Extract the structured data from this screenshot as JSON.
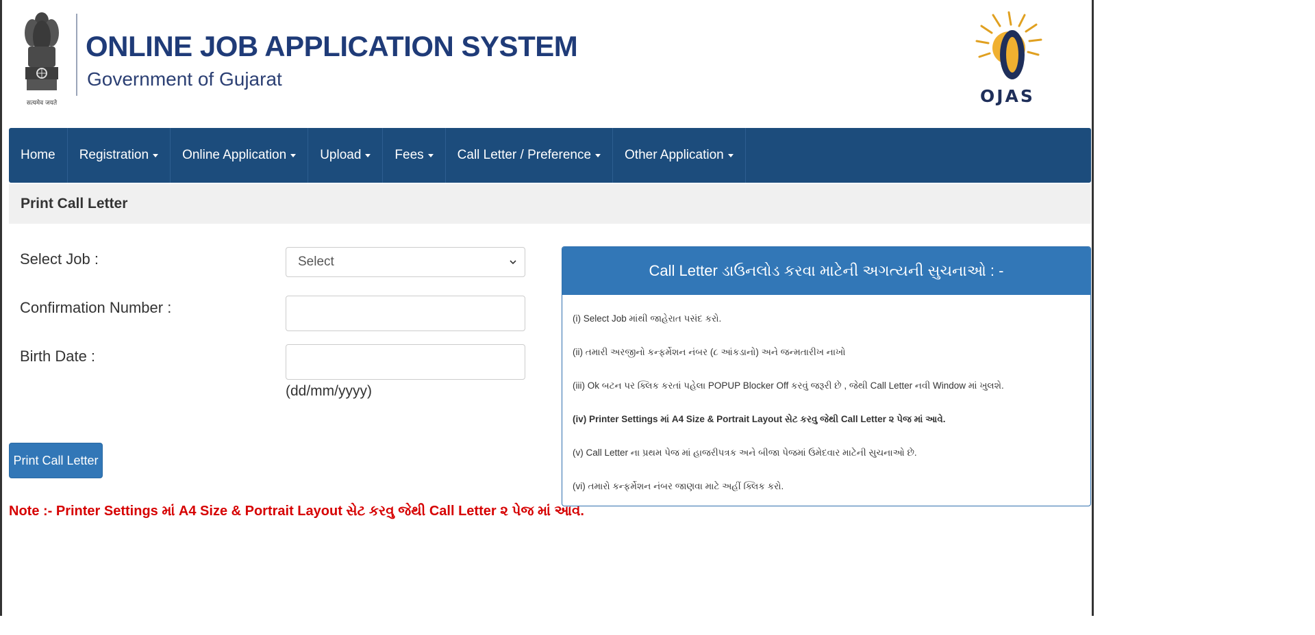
{
  "header": {
    "title": "ONLINE JOB APPLICATION SYSTEM",
    "subtitle": "Government of Gujarat",
    "emblem_motto": "सत्यमेव जयते",
    "logo_text": "OJAS"
  },
  "nav": {
    "items": [
      {
        "label": "Home",
        "dropdown": false
      },
      {
        "label": "Registration",
        "dropdown": true
      },
      {
        "label": "Online Application",
        "dropdown": true
      },
      {
        "label": "Upload",
        "dropdown": true
      },
      {
        "label": "Fees",
        "dropdown": true
      },
      {
        "label": "Call Letter / Preference",
        "dropdown": true
      },
      {
        "label": "Other Application",
        "dropdown": true
      }
    ]
  },
  "section": {
    "title": "Print Call Letter"
  },
  "form": {
    "job_label": "Select Job :",
    "job_selected": "Select",
    "confirmation_label": "Confirmation Number :",
    "birth_label": "Birth Date :",
    "birth_hint": "(dd/mm/yyyy)",
    "submit_label": "Print Call Letter"
  },
  "note": "Note :- Printer Settings માં A4 Size & Portrait Layout સેટ કરવુ જેથી Call Letter ૨ પેજ માં આવે.",
  "panel": {
    "title": "Call Letter ડાઉનલોડ કરવા માટેની અગત્યની સુચનાઓ : -",
    "items": [
      {
        "text": "(i) Select Job માંથી જાહેરાત પસંદ કરો.",
        "bold": false
      },
      {
        "text": "(ii) તમારી અરજીનો કન્ફર્મેશન નંબર (૮ આંકડાનો) અને જન્મતારીખ નાખો",
        "bold": false
      },
      {
        "text": "(iii) Ok બટન પર ક્લિક કરતાં પહેલા POPUP Blocker Off કરવું જરૂરી છે , જેથી Call Letter નવી Window માં ખુલશે.",
        "bold": false
      },
      {
        "text": "(iv) Printer Settings માં A4 Size & Portrait Layout સેટ કરવુ જેથી Call Letter ૨ પેજ માં આવે.",
        "bold": true
      },
      {
        "text": "(v) Call Letter ના પ્રથમ પેજ માં હાજરીપત્રક અને બીજા પેજમાં ઉમેદવાર માટેની સુચનાઓ છે.",
        "bold": false
      },
      {
        "text": "(vi) તમારો કન્ફર્મેશન નંબર જાણવા માટે અહીં ક્લિક કરો.",
        "bold": false
      }
    ]
  },
  "colors": {
    "navbar": "#1c4c7c",
    "panel_header": "#3277b7",
    "button": "#3277b7",
    "title_blue": "#1f3b78",
    "note_red": "#d60000"
  }
}
